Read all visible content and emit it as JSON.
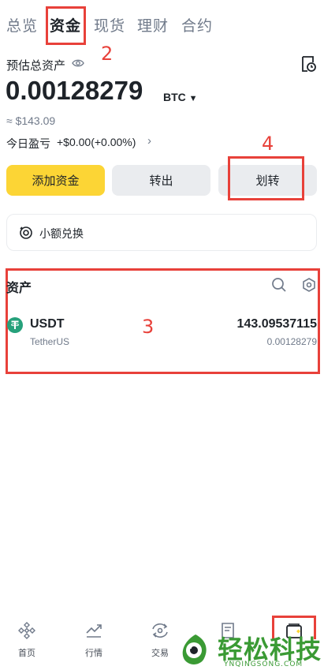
{
  "tabs": [
    {
      "label": "总览",
      "active": false
    },
    {
      "label": "资金",
      "active": true
    },
    {
      "label": "现货",
      "active": false
    },
    {
      "label": "理财",
      "active": false
    },
    {
      "label": "合约",
      "active": false
    }
  ],
  "summary": {
    "title": "预估总资产",
    "balance": "0.00128279",
    "currency": "BTC",
    "fiat_value": "≈ $143.09",
    "pnl_label": "今日盈亏",
    "pnl_value": "+$0.00(+0.00%)"
  },
  "actions": {
    "add_funds": "添加资金",
    "withdraw": "转出",
    "transfer": "划转"
  },
  "small_exchange": {
    "label": "小额兑换"
  },
  "assets": {
    "title": "资产",
    "items": [
      {
        "symbol": "USDT",
        "name": "TetherUS",
        "amount": "143.09537115",
        "btc_value": "0.00128279"
      }
    ]
  },
  "annotations": {
    "n2": "2",
    "n3": "3",
    "n4": "4"
  },
  "bottom_nav": [
    {
      "label": "首页",
      "icon": "home-icon"
    },
    {
      "label": "行情",
      "icon": "markets-icon"
    },
    {
      "label": "交易",
      "icon": "trade-icon"
    },
    {
      "label": "",
      "icon": "orders-icon"
    },
    {
      "label": "",
      "icon": "wallet-icon"
    }
  ],
  "watermark": {
    "text_main": "轻松科技",
    "text_sub": "YNQINGSONG.COM"
  },
  "colors": {
    "accent": "#fcd535",
    "annotation": "#e8413a",
    "tether": "#26a17b",
    "watermark": "#3a9a34"
  }
}
